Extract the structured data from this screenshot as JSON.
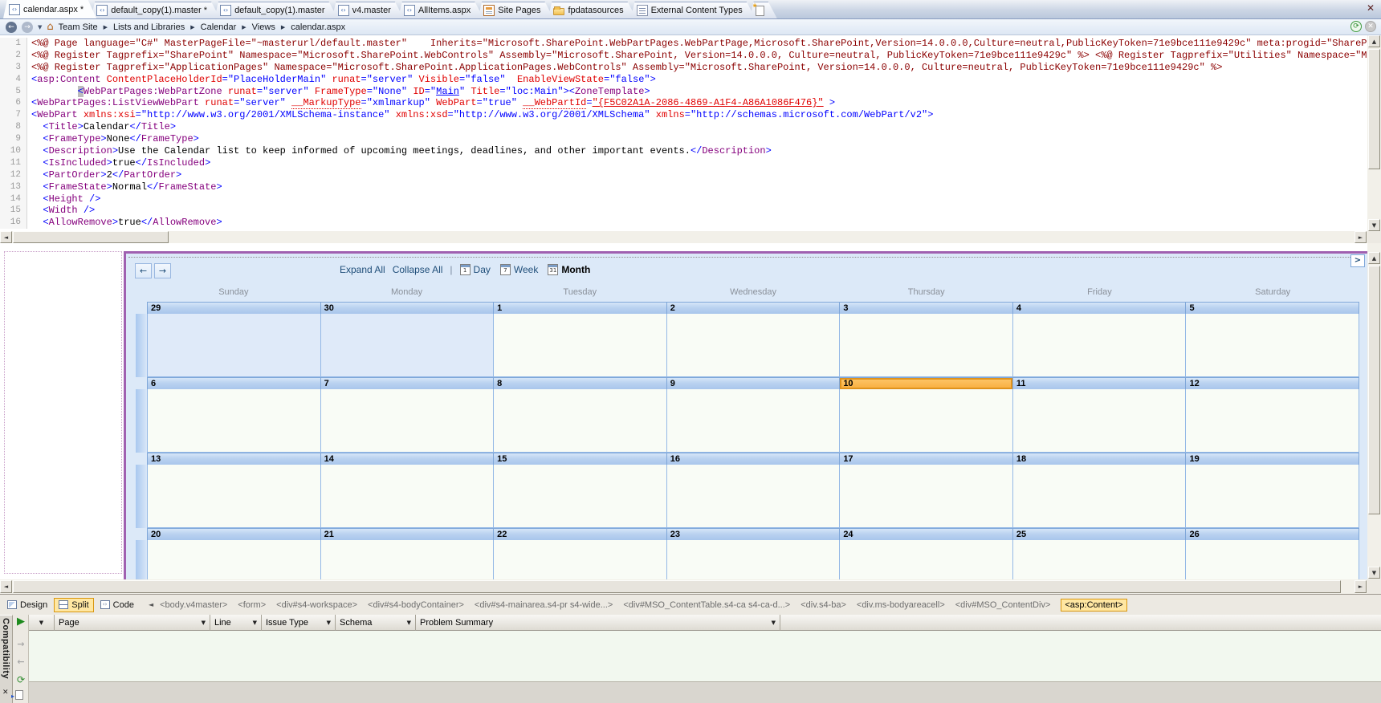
{
  "glyphs": {
    "crumb_sep": "▶",
    "back": "←",
    "forward": "→",
    "dropdown": "▼",
    "home": "⌂",
    "close": "✕",
    "refresh": "⟳",
    "gray_close": "✕",
    "pipe": "|",
    "menu_more": ">",
    "left_scroll": "◄",
    "right_scroll": "►",
    "up_scroll": "▲",
    "down_scroll": "▼",
    "tag_nav": "◄",
    "play": "▶",
    "next": "→",
    "prev": "←",
    "panel_close": "✕"
  },
  "tabs": [
    {
      "label": "calendar.aspx *",
      "icon": "aspx-page-icon",
      "active": true
    },
    {
      "label": "default_copy(1).master *",
      "icon": "master-page-icon",
      "active": false
    },
    {
      "label": "default_copy(1).master",
      "icon": "master-page-icon",
      "active": false
    },
    {
      "label": "v4.master",
      "icon": "master-page-icon",
      "active": false
    },
    {
      "label": "AllItems.aspx",
      "icon": "allitems-page-icon",
      "active": false
    },
    {
      "label": "Site Pages",
      "icon": "site-pages-icon",
      "active": false
    },
    {
      "label": "fpdatasources",
      "icon": "folder-icon",
      "active": false
    },
    {
      "label": "External Content Types",
      "icon": "content-types-icon",
      "active": false
    },
    {
      "label": "",
      "icon": "new-page-icon",
      "active": false
    }
  ],
  "breadcrumb": {
    "items": [
      "Team Site",
      "Lists and Libraries",
      "Calendar",
      "Views",
      "calendar.aspx"
    ]
  },
  "code": {
    "lines": [
      {
        "n": "1",
        "tokens": [
          [
            "dir",
            "<%@ Page language=\"C#\" MasterPageFile=\"~masterurl/default.master\"    Inherits=\"Microsoft.SharePoint.WebPartPages.WebPartPage,Microsoft.SharePoint,Version=14.0.0.0,Culture=neutral,PublicKeyToken=71e9bce111e9429c\" meta:progid=\"SharePoint.W"
          ]
        ]
      },
      {
        "n": "2",
        "tokens": [
          [
            "dir",
            "<%@ Register Tagprefix=\"SharePoint\" Namespace=\"Microsoft.SharePoint.WebControls\" Assembly=\"Microsoft.SharePoint, Version=14.0.0.0, Culture=neutral, PublicKeyToken=71e9bce111e9429c\" %> <%@ Register Tagprefix=\"Utilities\" Namespace=\"Microso"
          ]
        ]
      },
      {
        "n": "3",
        "tokens": [
          [
            "dir",
            "<%@ Register Tagprefix=\"ApplicationPages\" Namespace=\"Microsoft.SharePoint.ApplicationPages.WebControls\" Assembly=\"Microsoft.SharePoint, Version=14.0.0.0, Culture=neutral, PublicKeyToken=71e9bce111e9429c\" %>"
          ]
        ]
      },
      {
        "n": "4",
        "tokens": [
          [
            "d",
            "<"
          ],
          [
            "t",
            "asp:Content"
          ],
          [
            "x",
            " "
          ],
          [
            "a",
            "ContentPlaceHolderId"
          ],
          [
            "d",
            "="
          ],
          [
            "v",
            "\"PlaceHolderMain\""
          ],
          [
            "x",
            " "
          ],
          [
            "a",
            "runat"
          ],
          [
            "d",
            "="
          ],
          [
            "v",
            "\"server\""
          ],
          [
            "x",
            " "
          ],
          [
            "a",
            "Visible"
          ],
          [
            "d",
            "="
          ],
          [
            "v",
            "\"false\""
          ],
          [
            "x",
            "  "
          ],
          [
            "a",
            "EnableViewState"
          ],
          [
            "d",
            "="
          ],
          [
            "v",
            "\"false\""
          ],
          [
            "d",
            ">"
          ]
        ]
      },
      {
        "n": "5",
        "tokens": [
          [
            "x",
            "        "
          ],
          [
            "ds",
            "<"
          ],
          [
            "t",
            "WebPartPages:WebPartZone"
          ],
          [
            "x",
            " "
          ],
          [
            "a",
            "runat"
          ],
          [
            "d",
            "="
          ],
          [
            "v",
            "\"server\""
          ],
          [
            "x",
            " "
          ],
          [
            "a",
            "FrameType"
          ],
          [
            "d",
            "="
          ],
          [
            "v",
            "\"None\""
          ],
          [
            "x",
            " "
          ],
          [
            "a",
            "ID"
          ],
          [
            "d",
            "="
          ],
          [
            "v",
            "\""
          ],
          [
            "vu",
            "Main"
          ],
          [
            "v",
            "\""
          ],
          [
            "x",
            " "
          ],
          [
            "a",
            "Title"
          ],
          [
            "d",
            "="
          ],
          [
            "v",
            "\"loc:Main\""
          ],
          [
            "d",
            "><"
          ],
          [
            "t",
            "ZoneTemplate"
          ],
          [
            "d",
            ">"
          ]
        ]
      },
      {
        "n": "6",
        "tokens": [
          [
            "d",
            "<"
          ],
          [
            "t",
            "WebPartPages:ListViewWebPart"
          ],
          [
            "x",
            " "
          ],
          [
            "a",
            "runat"
          ],
          [
            "d",
            "="
          ],
          [
            "v",
            "\"server\""
          ],
          [
            "x",
            " "
          ],
          [
            "au",
            "__MarkupType"
          ],
          [
            "d",
            "="
          ],
          [
            "v",
            "\"xmlmarkup\""
          ],
          [
            "x",
            " "
          ],
          [
            "a",
            "WebPart"
          ],
          [
            "d",
            "="
          ],
          [
            "v",
            "\"true\""
          ],
          [
            "x",
            " "
          ],
          [
            "au",
            "__WebPartId"
          ],
          [
            "d",
            "="
          ],
          [
            "rv",
            "\"{F5C02A1A-2086-4869-A1F4-A86A1086F476}\""
          ],
          [
            "x",
            " "
          ],
          [
            "d",
            ">"
          ]
        ]
      },
      {
        "n": "7",
        "tokens": [
          [
            "d",
            "<"
          ],
          [
            "t",
            "WebPart"
          ],
          [
            "x",
            " "
          ],
          [
            "a",
            "xmlns:xsi"
          ],
          [
            "d",
            "="
          ],
          [
            "v",
            "\"http://www.w3.org/2001/XMLSchema-instance\""
          ],
          [
            "x",
            " "
          ],
          [
            "a",
            "xmlns:xsd"
          ],
          [
            "d",
            "="
          ],
          [
            "v",
            "\"http://www.w3.org/2001/XMLSchema\""
          ],
          [
            "x",
            " "
          ],
          [
            "a",
            "xmlns"
          ],
          [
            "d",
            "="
          ],
          [
            "v",
            "\"http://schemas.microsoft.com/WebPart/v2\""
          ],
          [
            "d",
            ">"
          ]
        ]
      },
      {
        "n": "8",
        "tokens": [
          [
            "x",
            "  "
          ],
          [
            "d",
            "<"
          ],
          [
            "t",
            "Title"
          ],
          [
            "d",
            ">"
          ],
          [
            "x",
            "Calendar"
          ],
          [
            "d",
            "</"
          ],
          [
            "t",
            "Title"
          ],
          [
            "d",
            ">"
          ]
        ]
      },
      {
        "n": "9",
        "tokens": [
          [
            "x",
            "  "
          ],
          [
            "d",
            "<"
          ],
          [
            "t",
            "FrameType"
          ],
          [
            "d",
            ">"
          ],
          [
            "x",
            "None"
          ],
          [
            "d",
            "</"
          ],
          [
            "t",
            "FrameType"
          ],
          [
            "d",
            ">"
          ]
        ]
      },
      {
        "n": "10",
        "tokens": [
          [
            "x",
            "  "
          ],
          [
            "d",
            "<"
          ],
          [
            "t",
            "Description"
          ],
          [
            "d",
            ">"
          ],
          [
            "x",
            "Use the Calendar list to keep informed of upcoming meetings, deadlines, and other important events."
          ],
          [
            "d",
            "</"
          ],
          [
            "t",
            "Description"
          ],
          [
            "d",
            ">"
          ]
        ]
      },
      {
        "n": "11",
        "tokens": [
          [
            "x",
            "  "
          ],
          [
            "d",
            "<"
          ],
          [
            "t",
            "IsIncluded"
          ],
          [
            "d",
            ">"
          ],
          [
            "x",
            "true"
          ],
          [
            "d",
            "</"
          ],
          [
            "t",
            "IsIncluded"
          ],
          [
            "d",
            ">"
          ]
        ]
      },
      {
        "n": "12",
        "tokens": [
          [
            "x",
            "  "
          ],
          [
            "d",
            "<"
          ],
          [
            "t",
            "PartOrder"
          ],
          [
            "d",
            ">"
          ],
          [
            "x",
            "2"
          ],
          [
            "d",
            "</"
          ],
          [
            "t",
            "PartOrder"
          ],
          [
            "d",
            ">"
          ]
        ]
      },
      {
        "n": "13",
        "tokens": [
          [
            "x",
            "  "
          ],
          [
            "d",
            "<"
          ],
          [
            "t",
            "FrameState"
          ],
          [
            "d",
            ">"
          ],
          [
            "x",
            "Normal"
          ],
          [
            "d",
            "</"
          ],
          [
            "t",
            "FrameState"
          ],
          [
            "d",
            ">"
          ]
        ]
      },
      {
        "n": "14",
        "tokens": [
          [
            "x",
            "  "
          ],
          [
            "d",
            "<"
          ],
          [
            "t",
            "Height"
          ],
          [
            "x",
            " "
          ],
          [
            "d",
            "/>"
          ]
        ]
      },
      {
        "n": "15",
        "tokens": [
          [
            "x",
            "  "
          ],
          [
            "d",
            "<"
          ],
          [
            "t",
            "Width"
          ],
          [
            "x",
            " "
          ],
          [
            "d",
            "/>"
          ]
        ]
      },
      {
        "n": "16",
        "tokens": [
          [
            "x",
            "  "
          ],
          [
            "d",
            "<"
          ],
          [
            "t",
            "AllowRemove"
          ],
          [
            "d",
            ">"
          ],
          [
            "x",
            "true"
          ],
          [
            "d",
            "</"
          ],
          [
            "t",
            "AllowRemove"
          ],
          [
            "d",
            ">"
          ]
        ]
      }
    ]
  },
  "calendar": {
    "nav_prev": "←",
    "nav_next": "→",
    "links": [
      "Expand All",
      "Collapse All"
    ],
    "views": [
      {
        "icon": "1",
        "label": "Day",
        "active": false
      },
      {
        "icon": "7",
        "label": "Week",
        "active": false
      },
      {
        "icon": "31",
        "label": "Month",
        "active": true
      }
    ],
    "day_names": [
      "Sunday",
      "Monday",
      "Tuesday",
      "Wednesday",
      "Thursday",
      "Friday",
      "Saturday"
    ],
    "weeks": [
      [
        {
          "day": "29",
          "out": true
        },
        {
          "day": "30",
          "out": true
        },
        {
          "day": "1"
        },
        {
          "day": "2"
        },
        {
          "day": "3"
        },
        {
          "day": "4"
        },
        {
          "day": "5"
        }
      ],
      [
        {
          "day": "6"
        },
        {
          "day": "7"
        },
        {
          "day": "8"
        },
        {
          "day": "9"
        },
        {
          "day": "10",
          "today": true
        },
        {
          "day": "11"
        },
        {
          "day": "12"
        }
      ],
      [
        {
          "day": "13"
        },
        {
          "day": "14"
        },
        {
          "day": "15"
        },
        {
          "day": "16"
        },
        {
          "day": "17"
        },
        {
          "day": "18"
        },
        {
          "day": "19"
        }
      ],
      [
        {
          "day": "20"
        },
        {
          "day": "21"
        },
        {
          "day": "22"
        },
        {
          "day": "23"
        },
        {
          "day": "24"
        },
        {
          "day": "25"
        },
        {
          "day": "26"
        }
      ]
    ],
    "today_color": "#f9ad3c"
  },
  "statusbar": {
    "views": [
      {
        "label": "Design",
        "icon": "design",
        "active": false
      },
      {
        "label": "Split",
        "icon": "split",
        "active": true
      },
      {
        "label": "Code",
        "icon": "code",
        "active": false
      }
    ],
    "tags": [
      "<body.v4master>",
      "<form>",
      "<div#s4-workspace>",
      "<div#s4-bodyContainer>",
      "<div#s4-mainarea.s4-pr s4-wide...>",
      "<div#MSO_ContentTable.s4-ca s4-ca-d...>",
      "<div.s4-ba>",
      "<div.ms-bodyareacell>",
      "<div#MSO_ContentDiv>",
      "<asp:Content>"
    ]
  },
  "panel": {
    "tab_label": "Compatibility",
    "columns": [
      "Page",
      "Line",
      "Issue Type",
      "Schema",
      "Problem Summary"
    ]
  }
}
